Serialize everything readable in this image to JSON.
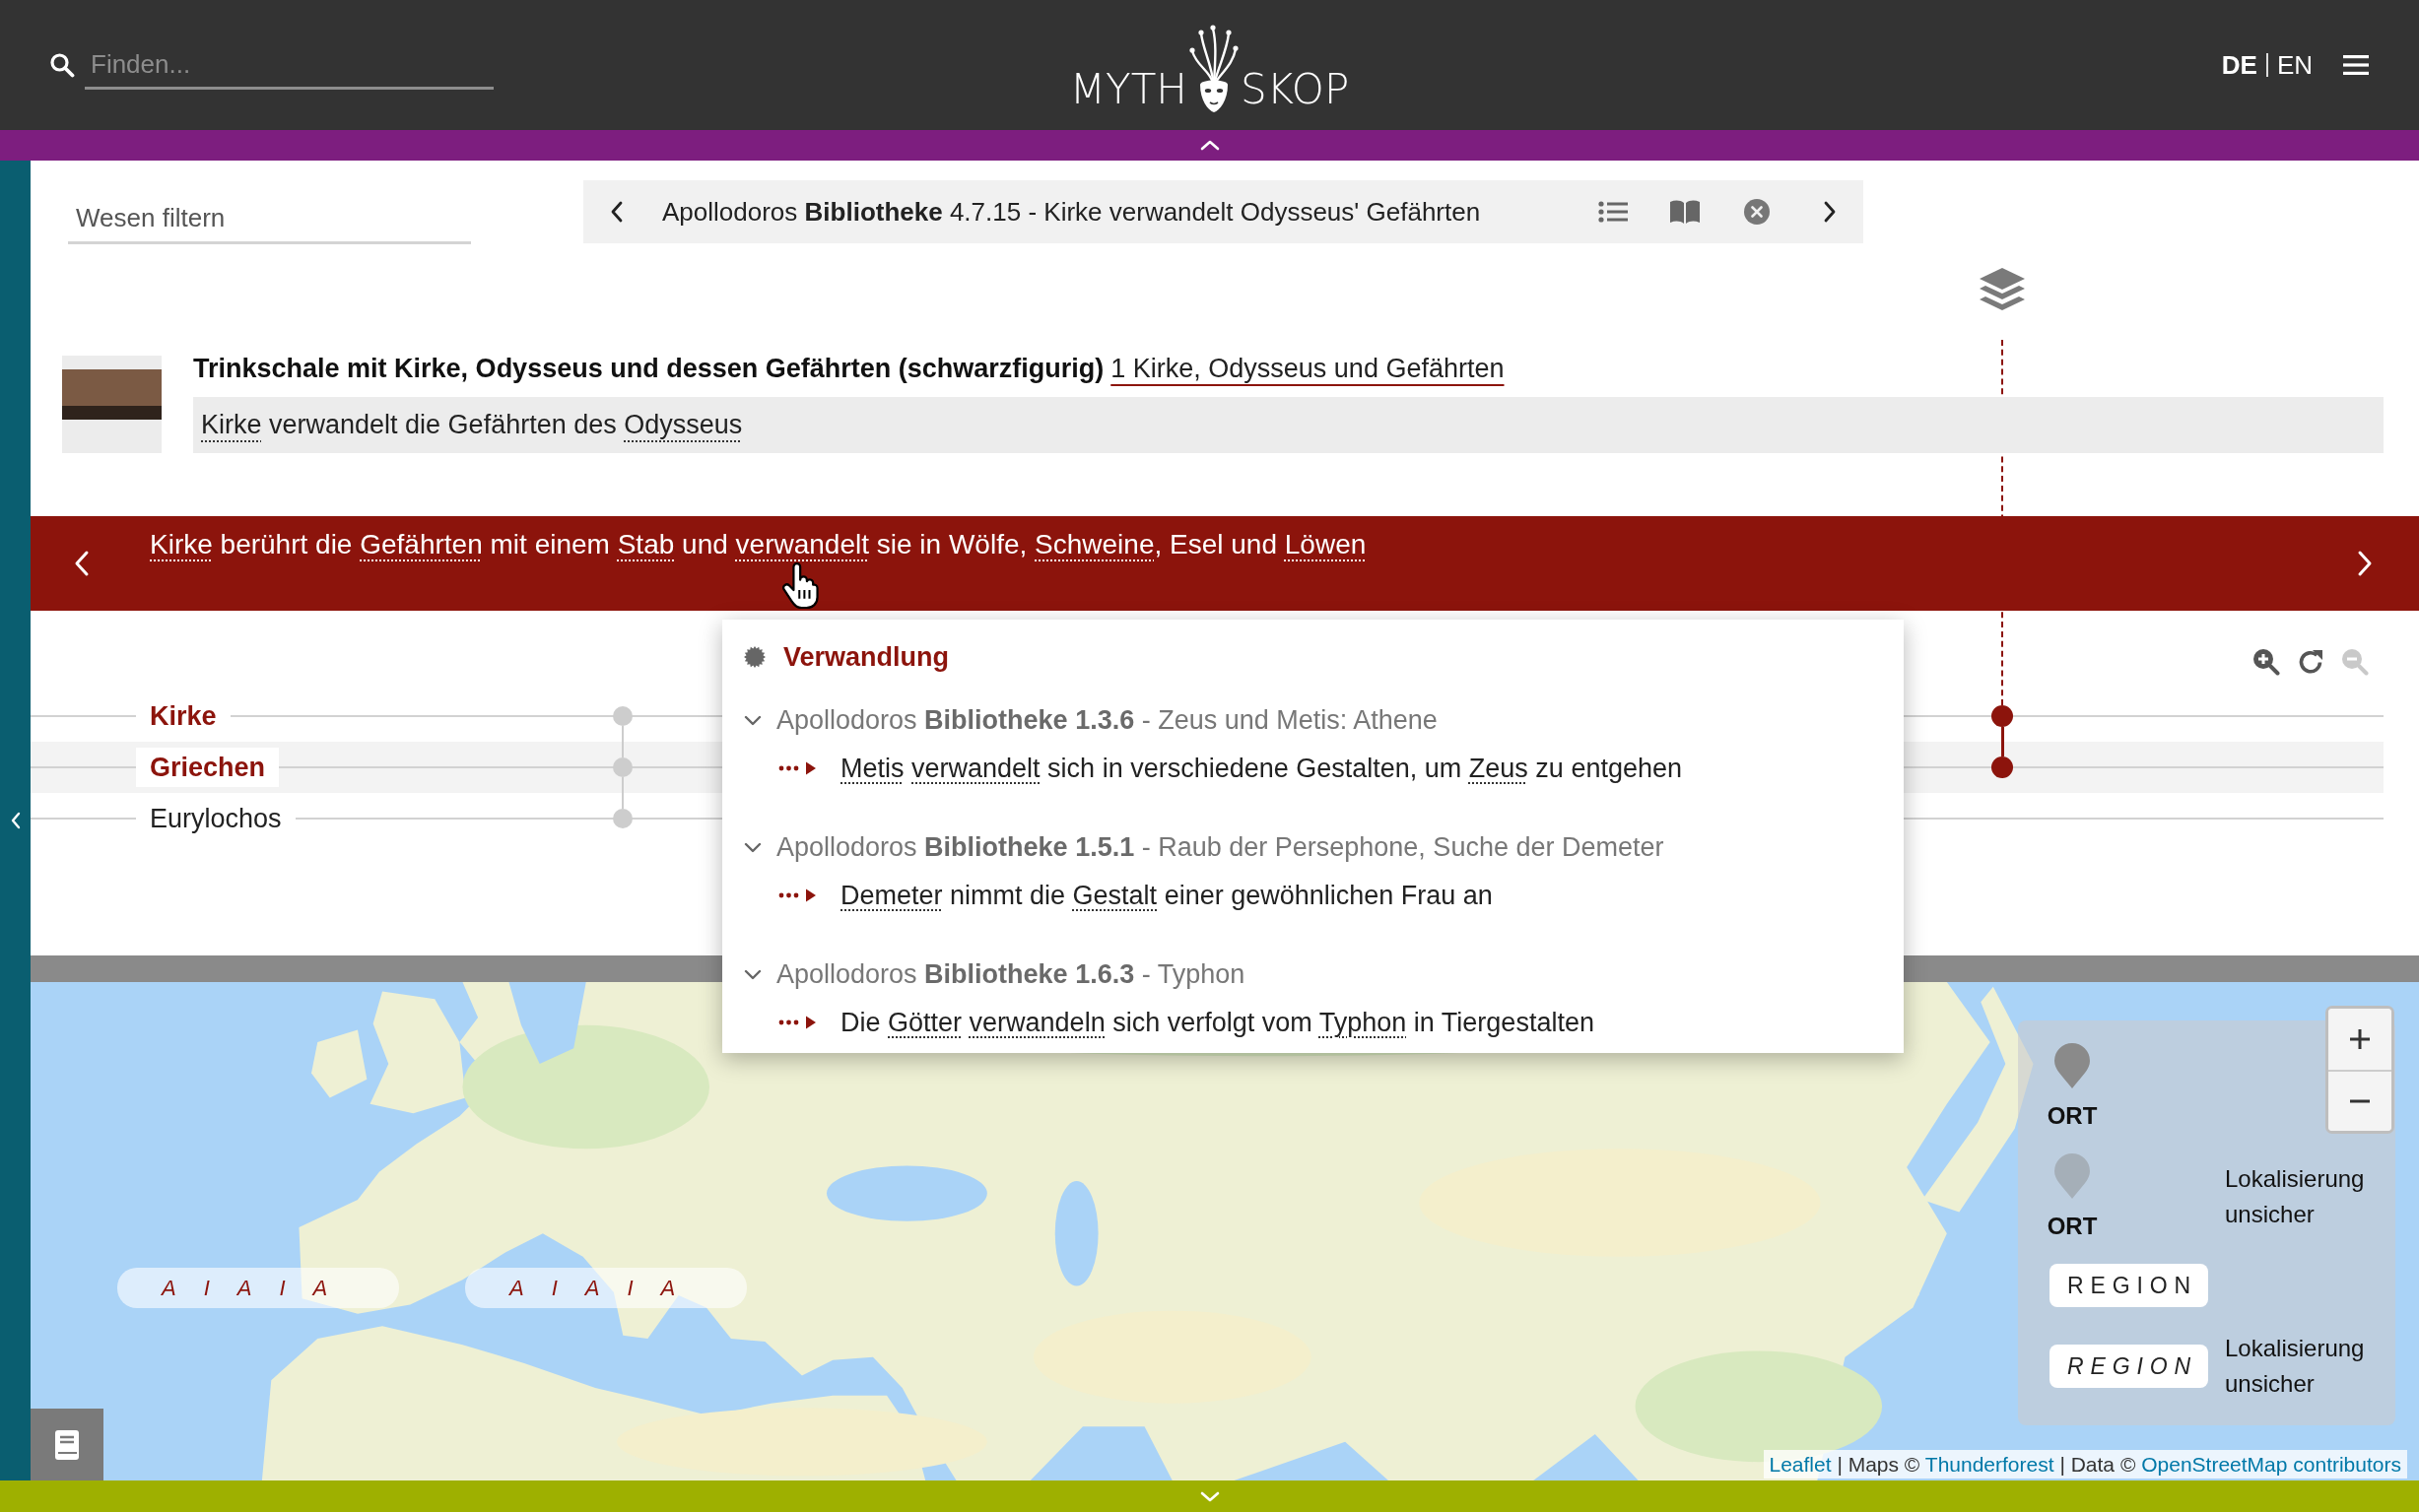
{
  "header": {
    "search": {
      "placeholder": "Finden..."
    },
    "logo": {
      "left": "MYTH",
      "right": "SKOP"
    },
    "languages": [
      {
        "label": "DE",
        "selected": true
      },
      {
        "label": "EN",
        "selected": false
      }
    ]
  },
  "filter": {
    "placeholder": "Wesen filtern"
  },
  "source_nav": {
    "title": "Apollodoros **Bibliotheke** 4.7.15 - Kirke verwandelt Odysseus' Gefährten"
  },
  "object": {
    "title": "Trinkschale mit Kirke, Odysseus und dessen Gefährten (schwarzfigurig)",
    "link": "1 Kirke, Odysseus und Gefährten",
    "description": [
      {
        "kind": "link",
        "text": "Kirke"
      },
      {
        "kind": "text",
        "text": " verwandelt die Gefährten des "
      },
      {
        "kind": "link",
        "text": "Odysseus"
      }
    ]
  },
  "event": {
    "segments": [
      {
        "kind": "link",
        "text": "Kirke"
      },
      {
        "kind": "text",
        "text": " berührt die "
      },
      {
        "kind": "link",
        "text": "Gefährten"
      },
      {
        "kind": "text",
        "text": " mit einem "
      },
      {
        "kind": "link",
        "text": "Stab"
      },
      {
        "kind": "text",
        "text": " und "
      },
      {
        "kind": "link",
        "text": "verwandelt"
      },
      {
        "kind": "text",
        "text": " sie in Wölfe, "
      },
      {
        "kind": "link",
        "text": "Schweine"
      },
      {
        "kind": "text",
        "text": ", Esel und "
      },
      {
        "kind": "link",
        "text": "Löwen"
      }
    ]
  },
  "timeline": {
    "tools": [
      {
        "kind": "zoom_in",
        "disabled": false
      },
      {
        "kind": "reset",
        "disabled": false
      },
      {
        "kind": "zoom_out",
        "disabled": true
      }
    ],
    "events": [
      {
        "current": false
      },
      {
        "current": true
      }
    ],
    "entities": [
      {
        "label": "Kirke",
        "highlighted": true,
        "in_events": [
          true,
          true
        ]
      },
      {
        "label": "Griechen",
        "highlighted": true,
        "in_events": [
          true,
          true
        ]
      },
      {
        "label": "Eurylochos",
        "highlighted": false,
        "in_events": [
          true,
          false
        ]
      }
    ]
  },
  "popup": {
    "title": "Verwandlung",
    "sections": [
      {
        "heading": "Apollodoros **Bibliotheke 1.3.6** - Zeus und Metis: Athene",
        "expanded": true,
        "items": [
          {
            "segments": [
              {
                "kind": "link",
                "text": "Metis"
              },
              {
                "kind": "link",
                "text": "verwandelt"
              },
              {
                "kind": "text",
                "text": " sich in verschiedene Gestalten, um "
              },
              {
                "kind": "link",
                "text": "Zeus"
              },
              {
                "kind": "text",
                "text": " zu entgehen"
              }
            ]
          }
        ]
      },
      {
        "heading": "Apollodoros **Bibliotheke 1.5.1** - Raub der Persephone, Suche der Demeter",
        "expanded": true,
        "items": [
          {
            "segments": [
              {
                "kind": "link",
                "text": "Demeter"
              },
              {
                "kind": "text",
                "text": " nimmt die "
              },
              {
                "kind": "link",
                "text": "Gestalt"
              },
              {
                "kind": "text",
                "text": " einer gewöhnlichen Frau an"
              }
            ]
          }
        ]
      },
      {
        "heading": "Apollodoros **Bibliotheke 1.6.3** - Typhon",
        "expanded": true,
        "items": [
          {
            "segments": [
              {
                "kind": "text",
                "text": "Die "
              },
              {
                "kind": "link",
                "text": "Götter"
              },
              {
                "kind": "link",
                "text": "verwandeln"
              },
              {
                "kind": "text",
                "text": " sich verfolgt vom "
              },
              {
                "kind": "link",
                "text": "Typhon"
              },
              {
                "kind": "text",
                "text": " in Tiergestalten"
              }
            ]
          }
        ]
      }
    ]
  },
  "map": {
    "labels": [
      {
        "text": "AIAIA",
        "uncertain": true
      },
      {
        "text": "AIAIA",
        "uncertain": true
      }
    ],
    "zoom_buttons": [
      {
        "kind": "zoom_in",
        "disabled": false
      },
      {
        "kind": "zoom_out",
        "disabled": false
      }
    ],
    "legend": [
      {
        "kind": "place",
        "label": "ORT",
        "uncertain": false
      },
      {
        "kind": "place",
        "label": "ORT",
        "uncertain": true,
        "note": "Lokalisierung unsicher"
      },
      {
        "kind": "region",
        "label": "REGION",
        "uncertain": false
      },
      {
        "kind": "region",
        "label": "REGION",
        "uncertain": true,
        "note": "Lokalisierung unsicher"
      }
    ],
    "attribution": [
      {
        "kind": "link",
        "text": "Leaflet"
      },
      {
        "kind": "text",
        "text": " | Maps © "
      },
      {
        "kind": "link",
        "text": "Thunderforest"
      },
      {
        "kind": "text",
        "text": " | Data © "
      },
      {
        "kind": "link",
        "text": "OpenStreetMap contributors"
      }
    ]
  }
}
